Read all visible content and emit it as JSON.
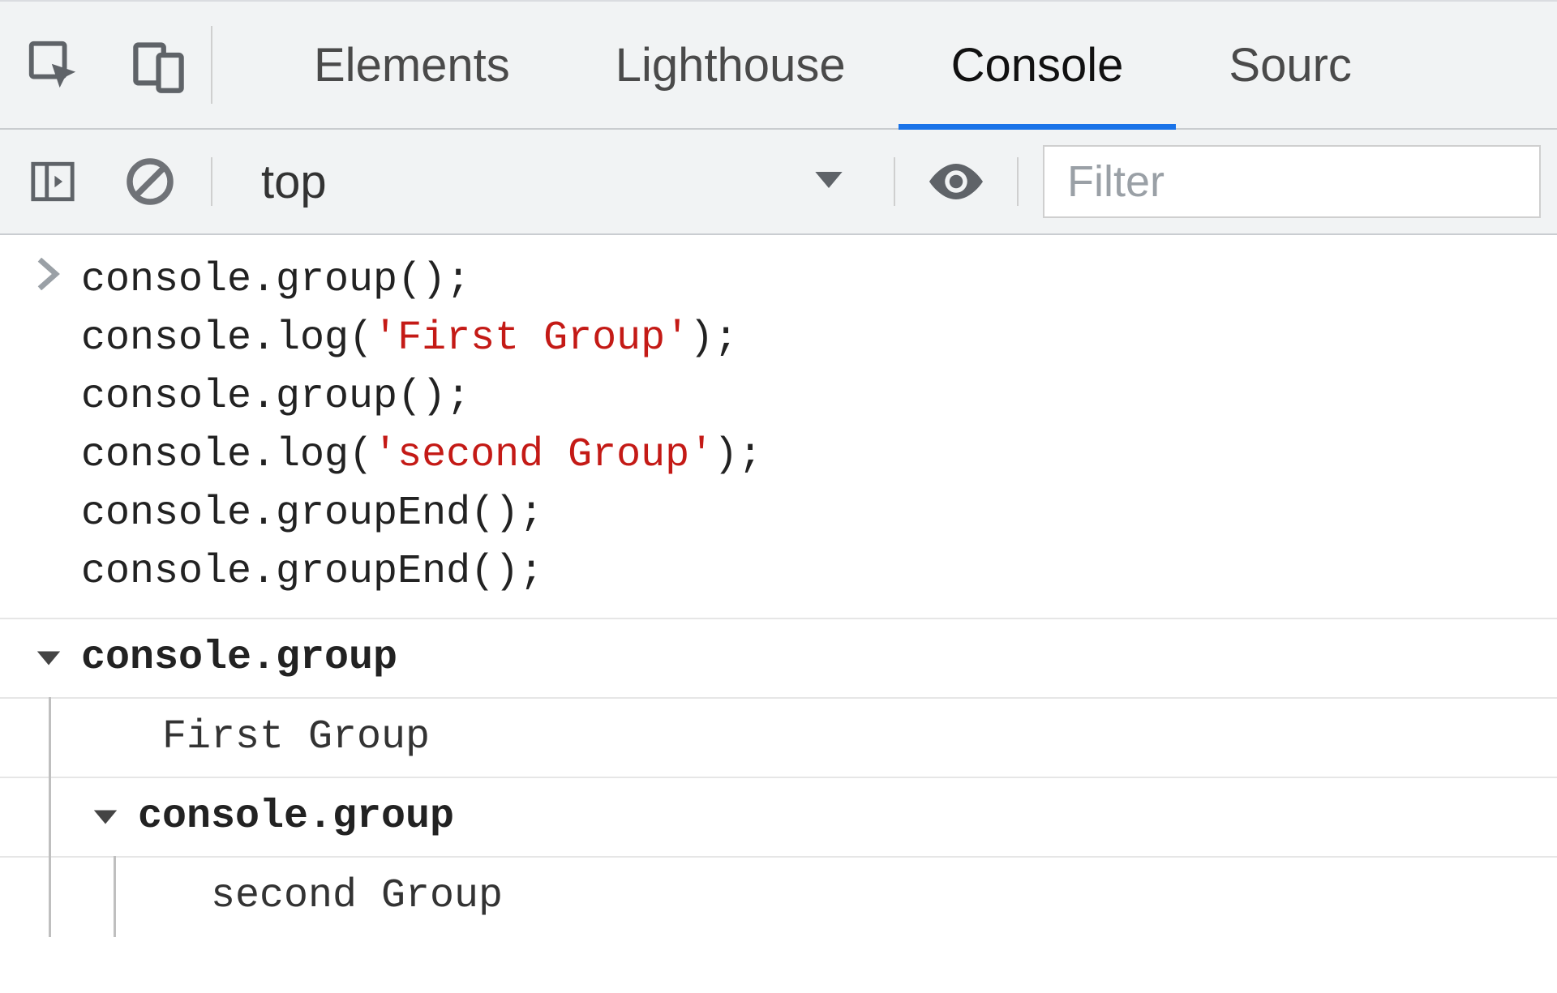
{
  "tabs": {
    "elements": "Elements",
    "lighthouse": "Lighthouse",
    "console": "Console",
    "sources": "Sourc"
  },
  "toolbar": {
    "context": "top",
    "filter_placeholder": "Filter"
  },
  "input": {
    "lines": [
      "console.group();",
      "console.log('First Group');",
      "console.group();",
      "console.log('second Group');",
      "console.groupEnd();",
      "console.groupEnd();"
    ],
    "string_literals": [
      "'First Group'",
      "'second Group'"
    ]
  },
  "output": {
    "group1": {
      "header": "console.group",
      "log": "First Group",
      "group2": {
        "header": "console.group",
        "log": "second Group"
      }
    }
  },
  "colors": {
    "accent": "#1a73e8",
    "string": "#c41a16"
  }
}
